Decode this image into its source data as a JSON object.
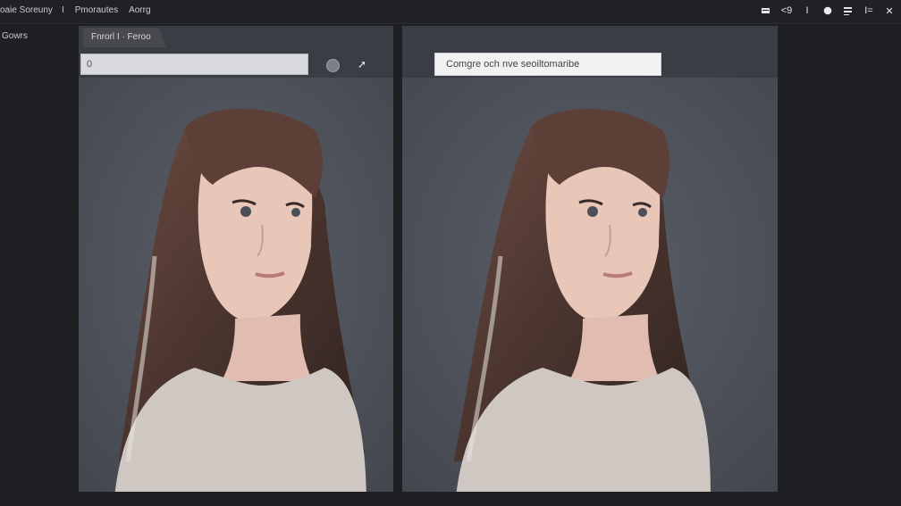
{
  "menu": [
    "oaie Soreuny",
    "I",
    "Pmorautes",
    "Aorrg"
  ],
  "sidebar": {
    "label": "Gowrs"
  },
  "left_panel": {
    "tab_label": "Fnrorl I · Feroo",
    "search_value": "0"
  },
  "right_panel": {
    "prompt_text": "Comgre och nve seoiltomaribe"
  },
  "toolbar_icons": [
    "menu-icon",
    "nine-icon",
    "info-icon",
    "record-icon",
    "list-icon",
    "layout-icon",
    "close-icon"
  ],
  "toolbar": {
    "nine_label": "<9",
    "i_label": "I",
    "ie_label": "I=",
    "x_label": "✕"
  },
  "colors": {
    "panel": "#4c5059",
    "background": "#1e1f22",
    "hair": "#5b4036",
    "skin": "#e9c9bd",
    "sweater": "#cfc7c2"
  }
}
